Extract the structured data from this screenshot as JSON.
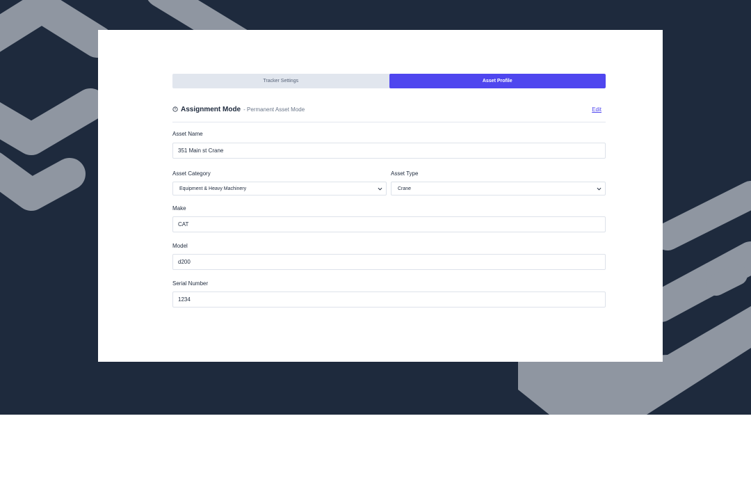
{
  "tabs": [
    {
      "label": "Tracker Settings",
      "active": false
    },
    {
      "label": "Asset Profile",
      "active": true
    }
  ],
  "assignment": {
    "title": "Assignment Mode",
    "subtitle": "- Permanent Asset Mode",
    "edit_label": "Edit"
  },
  "form": {
    "asset_name": {
      "label": "Asset Name",
      "value": "351 Main st Crane"
    },
    "asset_category": {
      "label": "Asset Category",
      "value": "Equipment & Heavy Machinery"
    },
    "asset_type": {
      "label": "Asset Type",
      "value": "Crane"
    },
    "make": {
      "label": "Make",
      "value": "CAT"
    },
    "model": {
      "label": "Model",
      "value": "d200"
    },
    "serial_number": {
      "label": "Serial Number",
      "value": "1234"
    }
  },
  "colors": {
    "backdrop": "#1e2a3d",
    "shape": "#8f96a1",
    "accent": "#4f46ef",
    "tab_inactive": "#e1e6ee"
  },
  "icons": [
    "info-icon",
    "chevron-down-icon"
  ]
}
